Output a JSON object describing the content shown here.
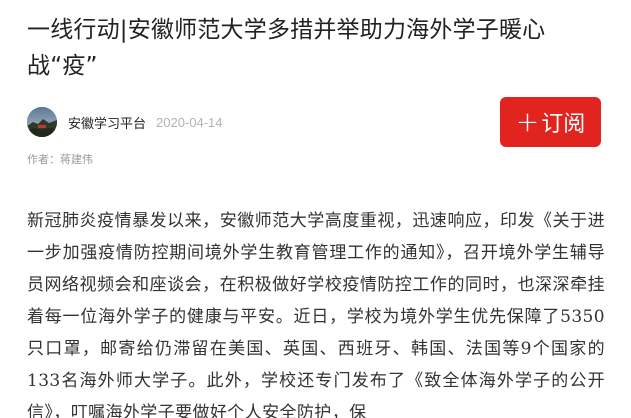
{
  "article": {
    "title": "一线行动|安徽师范大学多措并举助力海外学子暖心战“疫”",
    "source_name": "安徽学习平台",
    "publish_date": "2020-04-14",
    "author_line": "作者：蒋建伟",
    "body": "新冠肺炎疫情暴发以来，安徽师范大学高度重视，迅速响应，印发《关于进一步加强疫情防控期间境外学生教育管理工作的通知》，召开境外学生辅导员网络视频会和座谈会，在积极做好学校疫情防控工作的同时，也深深牵挂着每一位海外学子的健康与平安。近日，学校为境外学生优先保障了5350只口罩，邮寄给仍滞留在美国、英国、西班牙、韩国、法国等9个国家的133名海外师大学子。此外，学校还专门发布了《致全体海外学子的公开信》，叮嘱海外学子要做好个人安全防护，保"
  },
  "subscribe": {
    "plus_symbol": "+",
    "label": "订阅",
    "color": "#e22420"
  },
  "icons": {
    "avatar": "avatar-icon"
  }
}
